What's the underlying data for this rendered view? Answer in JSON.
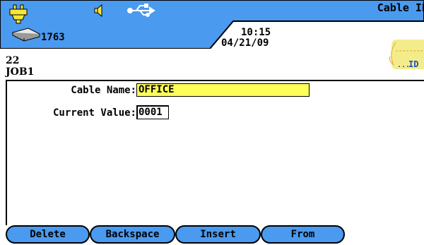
{
  "status": {
    "title": "Cable ID",
    "count": "1763",
    "time": "10:15",
    "date": "04/21/09",
    "icons": [
      "power-plug-icon",
      "speaker-icon",
      "usb-icon",
      "cable-reel-icon",
      "id-tag-icon"
    ],
    "tag_label": "ID"
  },
  "info": {
    "line1": "22",
    "line2": "JOB1"
  },
  "form": {
    "cable_name_label": "Cable Name:",
    "cable_name_value": "OFFICE",
    "current_value_label": "Current Value:",
    "current_value_value": "0001"
  },
  "softkeys": [
    {
      "label": "Delete"
    },
    {
      "label": "Backspace"
    },
    {
      "label": "Insert"
    },
    {
      "label": "From"
    }
  ],
  "colors": {
    "status_blue": "#4a9af0",
    "field_yellow": "#ffff5a",
    "softkey_blue": "#4a9af0"
  }
}
